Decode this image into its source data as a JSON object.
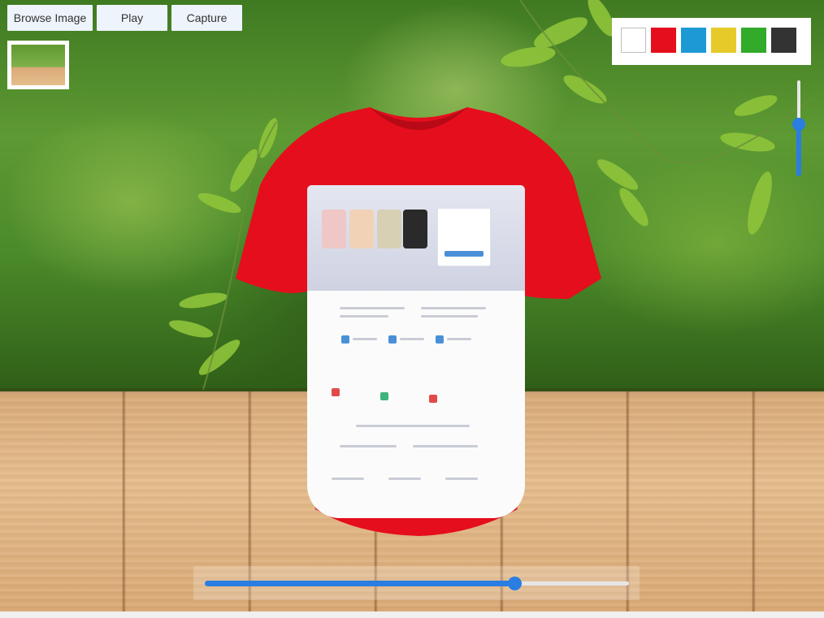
{
  "toolbar": {
    "browse_label": "Browse Image",
    "play_label": "Play",
    "capture_label": "Capture"
  },
  "background_thumbnail": {
    "icon": "background-thumbnail-icon"
  },
  "palette": {
    "colors": [
      "#ffffff",
      "#e50e1d",
      "#1d9ad6",
      "#e6ca2a",
      "#32aa2a",
      "#333333"
    ],
    "selected_color": "#e50e1d"
  },
  "vertical_slider": {
    "value": 0.45
  },
  "horizontal_slider": {
    "value": 0.73
  },
  "model": {
    "shirt_color": "#e50e1d",
    "icon": "tshirt-model-icon"
  }
}
